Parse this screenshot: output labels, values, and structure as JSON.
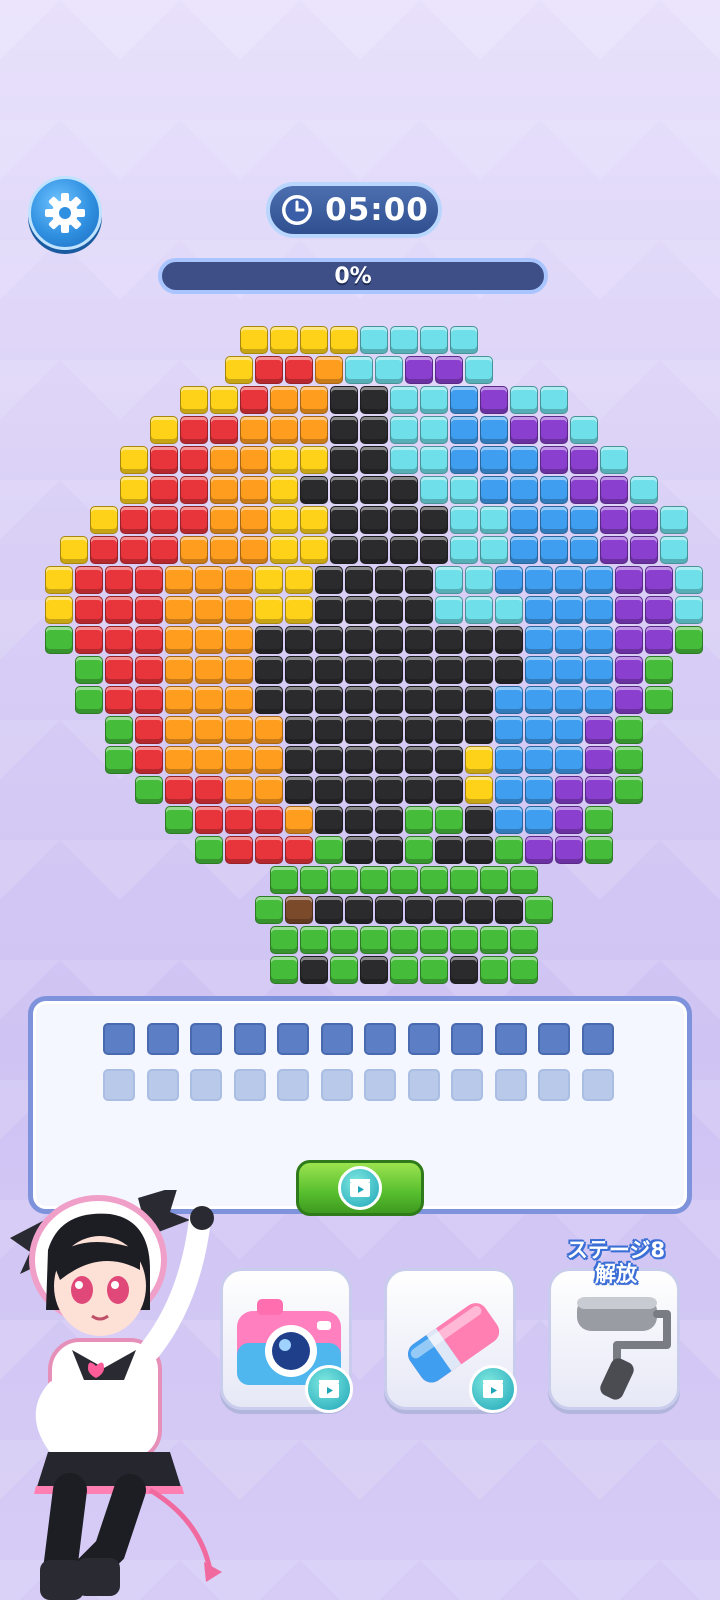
{
  "hud": {
    "timer": "05:00",
    "progress_label": "0%",
    "progress_value": 0
  },
  "icons": {
    "settings": "gear-icon",
    "timer": "clock-icon",
    "video": "video-play-icon",
    "camera": "camera-icon",
    "eraser": "eraser-icon",
    "roller": "paint-roller-icon"
  },
  "colors": {
    "Y": "#ffd21a",
    "R": "#e8353c",
    "O": "#ff9d1e",
    "G": "#46bd3a",
    "K": "#2b2b2e",
    "C": "#6fe0ea",
    "B": "#3f9ef0",
    "P": "#8a3fcf",
    "N": "#7a4a2a"
  },
  "board": {
    "rows": [
      "..........................................",
      ".......YYYYCCCC.......",
      "......YRROCCPPC......",
      ".....YYROOKKCCBPCC....",
      "....YRROOOKKCCBBPPC...",
      "...YRROOYYKKCCBBBPPC..",
      "...YRROOYKKKKCCBBBPPC.",
      "..YRRROOYYKKKKCCBBBPPC",
      ".YRRROOOYYKKKKCCBBBPPC",
      ".YRRROOOYYKKKKCCBBBBPPC",
      ".YRRROOOYYKKKKCCCBBBPPC",
      ".GRRROOOKKKKKKKKKBBBPPG",
      "..GRROOOKKKKKKKKKBBBPG.",
      "..GRROOOKKKKKKKKBBBBPG.",
      "...GROOOOKKKKKKKBBBPG..",
      "...GROOOOKKKKKKYBBBPG..",
      "....GRROOKKKKKKYBBPPG..",
      ".....GRRROKKKGGKBBPG...",
      "......GRRRGKKGKKGPPG...",
      "........GGGGGGGGG.....",
      "........GNKKKKKKKG.....",
      "........GGGGGGGGG.....",
      "........GKGKGGKGG....."
    ]
  },
  "tray": {
    "slot_count": 12
  },
  "tools": {
    "roller_lock_line1": "ステージ8",
    "roller_lock_line2": "解放"
  }
}
